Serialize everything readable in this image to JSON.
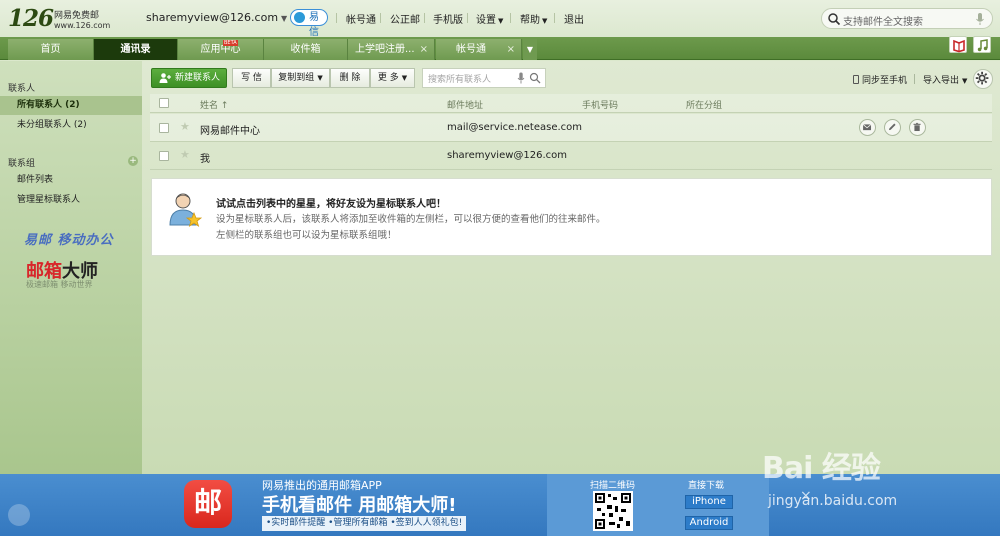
{
  "header": {
    "logo_number": "126",
    "logo_name": "网易免费邮",
    "logo_url": "www.126.com",
    "account": "sharemyview@126.com",
    "yixin": "易信",
    "nav": [
      {
        "label": "帐号通",
        "has_caret": false
      },
      {
        "label": "公正邮",
        "has_caret": false
      },
      {
        "label": "手机版",
        "has_caret": false
      },
      {
        "label": "设置",
        "has_caret": true
      },
      {
        "label": "帮助",
        "has_caret": true
      },
      {
        "label": "退出",
        "has_caret": false
      }
    ],
    "search_placeholder": "支持邮件全文搜索"
  },
  "tabs": [
    {
      "label": "首页"
    },
    {
      "label": "通讯录"
    },
    {
      "label": "应用中心"
    },
    {
      "label": "收件箱"
    },
    {
      "label": "上学吧注册..."
    },
    {
      "label": "帐号通"
    }
  ],
  "tab_beta": "BETA",
  "sidebar": {
    "contacts_header": "联系人",
    "contacts": [
      {
        "label": "所有联系人 (2)"
      },
      {
        "label": "未分组联系人 (2)"
      }
    ],
    "groups_header": "联系组",
    "groups": [
      {
        "label": "邮件列表"
      },
      {
        "label": "管理星标联系人"
      }
    ],
    "promo_top": "易邮 移动办公",
    "promo_brand_a": "邮箱",
    "promo_brand_b": "大师",
    "promo_sub": "极速邮箱 移动世界"
  },
  "toolbar": {
    "new_contact": "新建联系人",
    "write": "写 信",
    "copy_to_group": "复制到组",
    "delete": "删 除",
    "more": "更 多",
    "search_placeholder": "搜索所有联系人",
    "sync": "同步至手机",
    "import_export": "导入导出"
  },
  "table": {
    "columns": [
      "姓名 ↑",
      "邮件地址",
      "手机号码",
      "所在分组"
    ],
    "rows": [
      {
        "name": "网易邮件中心",
        "email": "mail@service.netease.com",
        "phone": "",
        "group": ""
      },
      {
        "name": "我",
        "email": "sharemyview@126.com",
        "phone": "",
        "group": ""
      }
    ]
  },
  "tip": {
    "title": "试试点击列表中的星星，将好友设为星标联系人吧！",
    "line1": "设为星标联系人后，该联系人将添加至收件箱的左侧栏，可以很方便的查看他们的往来邮件。",
    "line2": "左侧栏的联系组也可以设为星标联系组哦！"
  },
  "banner": {
    "app_glyph": "邮",
    "top": "网易推出的通用邮箱APP",
    "main": "手机看邮件 用邮箱大师!",
    "sub": "•实时邮件提醒 •管理所有邮箱 •签到人人领礼包!",
    "scan": "扫描二维码",
    "download": "直接下载",
    "iphone": "iPhone",
    "android": "Android"
  },
  "watermark": {
    "logo": "Bai 经验",
    "url": "jingyan.baidu.com"
  },
  "colors": {
    "tab_bar": "#5b8a3c",
    "active_tab": "#1c3a0c",
    "new_contact_button": "#3d8f25",
    "banner": "#3478bf",
    "app_icon": "#d9271d"
  }
}
